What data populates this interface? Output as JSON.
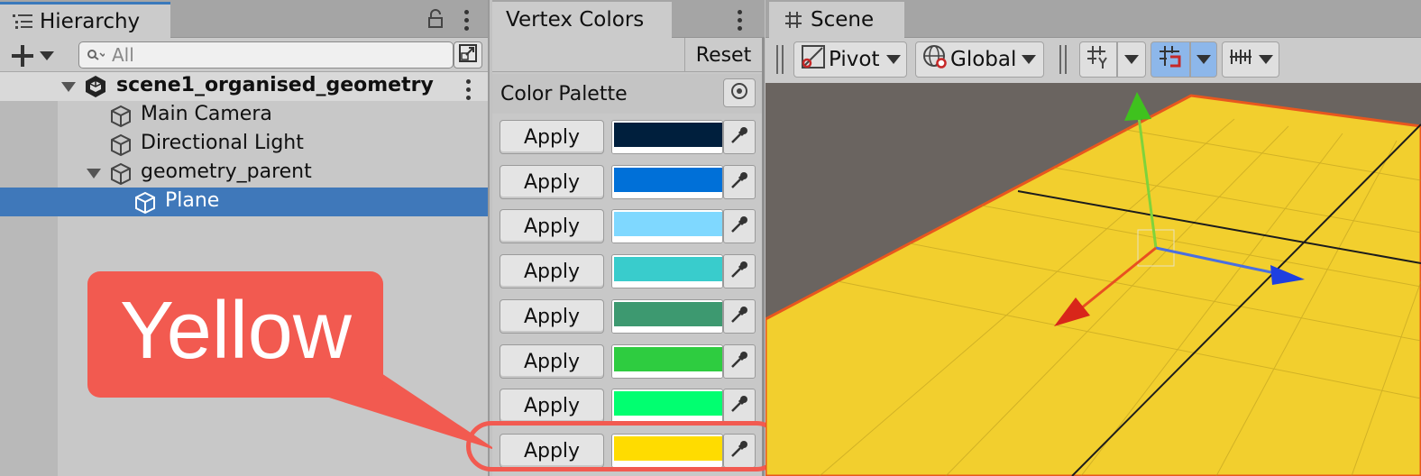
{
  "hierarchy": {
    "tab_title": "Hierarchy",
    "search_placeholder": "All",
    "scene_name": "scene1_organised_geometry",
    "items": [
      {
        "label": "Main Camera"
      },
      {
        "label": "Directional Light"
      },
      {
        "label": "geometry_parent"
      },
      {
        "label": "Plane"
      }
    ]
  },
  "annotation": {
    "text": "Yellow",
    "color": "#f25a50"
  },
  "vertex_colors": {
    "tab_title": "Vertex Colors",
    "reset_label": "Reset",
    "palette_title": "Color Palette",
    "rows": [
      {
        "apply_label": "Apply",
        "color": "#001f3d"
      },
      {
        "apply_label": "Apply",
        "color": "#0070d8"
      },
      {
        "apply_label": "Apply",
        "color": "#7fd8ff"
      },
      {
        "apply_label": "Apply",
        "color": "#39cccc"
      },
      {
        "apply_label": "Apply",
        "color": "#3d9970"
      },
      {
        "apply_label": "Apply",
        "color": "#2ecc40"
      },
      {
        "apply_label": "Apply",
        "color": "#01ff70"
      },
      {
        "apply_label": "Apply",
        "color": "#ffdc00"
      }
    ],
    "highlighted_row": 8
  },
  "scene": {
    "tab_title": "Scene",
    "pivot_label": "Pivot",
    "global_label": "Global",
    "plane_color": "#f2cf2e",
    "background_color": "#6a6460"
  }
}
